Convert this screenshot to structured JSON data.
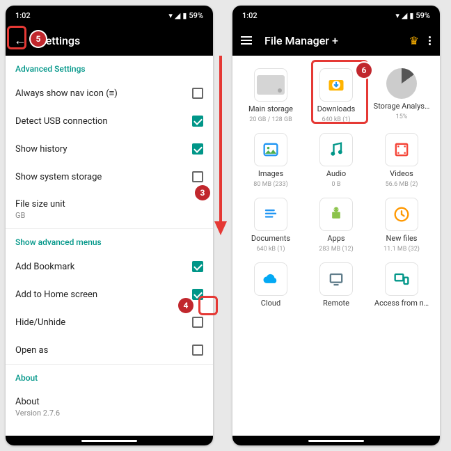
{
  "status": {
    "time": "1:02",
    "battery": "59%"
  },
  "left": {
    "appbar_title": "Settings",
    "sections": {
      "advanced": "Advanced Settings",
      "menus": "Show advanced menus",
      "about": "About"
    },
    "rows": {
      "nav_icon": "Always show nav icon (≡)",
      "usb": "Detect USB connection",
      "history": "Show history",
      "system_storage": "Show system storage",
      "filesize": "File size unit",
      "filesize_sub": "GB",
      "bookmark": "Add Bookmark",
      "homescreen": "Add to Home screen",
      "hide": "Hide/Unhide",
      "openas": "Open as",
      "about": "About",
      "about_sub": "Version 2.7.6"
    }
  },
  "right": {
    "appbar_title": "File Manager +",
    "tiles": {
      "main": {
        "label": "Main storage",
        "sub": "20 GB / 128 GB"
      },
      "downloads": {
        "label": "Downloads",
        "sub": "640 kB (1)"
      },
      "analysis": {
        "label": "Storage Analys…",
        "sub": "15%"
      },
      "images": {
        "label": "Images",
        "sub": "80 MB (233)"
      },
      "audio": {
        "label": "Audio",
        "sub": "0 B"
      },
      "videos": {
        "label": "Videos",
        "sub": "56.6 MB (2)"
      },
      "documents": {
        "label": "Documents",
        "sub": "640 kB (1)"
      },
      "apps": {
        "label": "Apps",
        "sub": "283 MB (12)"
      },
      "newfiles": {
        "label": "New files",
        "sub": "11.1 MB (32)"
      },
      "cloud": {
        "label": "Cloud",
        "sub": ""
      },
      "remote": {
        "label": "Remote",
        "sub": ""
      },
      "access": {
        "label": "Access from n…",
        "sub": ""
      }
    }
  },
  "annotations": {
    "b3": "3",
    "b4": "4",
    "b5": "5",
    "b6": "6"
  }
}
